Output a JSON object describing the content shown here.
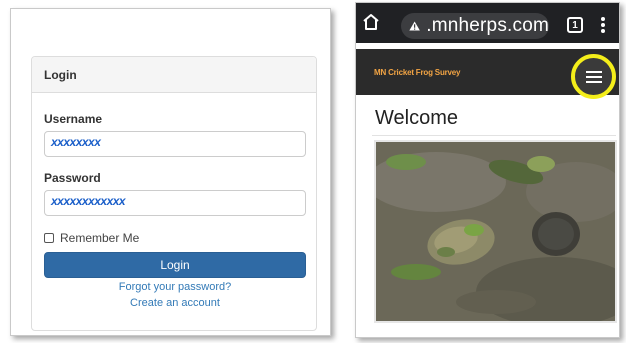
{
  "login_panel": {
    "header": "Login",
    "username_label": "Username",
    "username_value": "xxxxxxxx",
    "password_label": "Password",
    "password_value": "xxxxxxxxxxxx",
    "remember_label": "Remember Me",
    "login_button": "Login",
    "forgot_link": "Forgot your password?",
    "create_link": "Create an account"
  },
  "phone": {
    "url": ".mnherps.com",
    "tab_count": "1",
    "site_title": "MN Cricket Frog Survey",
    "heading": "Welcome",
    "icons": [
      "home-icon",
      "not-secure-warning-icon",
      "tabs-icon",
      "more-options-icon",
      "hamburger-menu-icon"
    ],
    "highlight_color": "#f4ee1a"
  },
  "colors": {
    "login_button": "#2f6aa5",
    "link": "#337ab7",
    "site_title": "#f2a444",
    "browser_bar": "#202124"
  }
}
